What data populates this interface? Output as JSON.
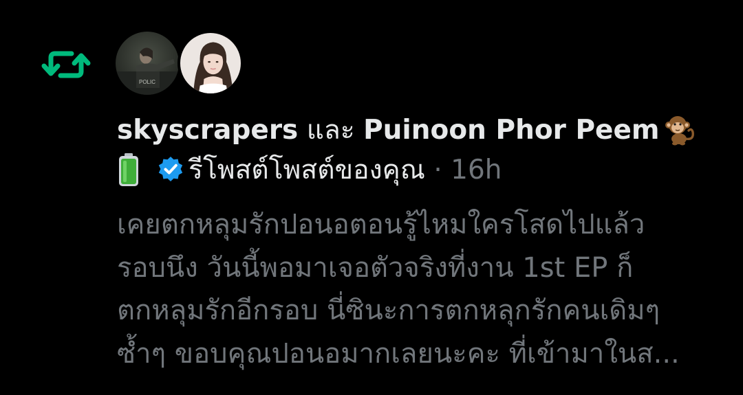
{
  "notification": {
    "user1": "skyscrapers",
    "conjunction": "และ",
    "user2": "Puinoon Phor Peem",
    "user2_emoji": "monkey-icon",
    "user2_badge_emoji": "battery-icon",
    "action": "รีโพสต์โพสต์ของคุณ",
    "separator": "·",
    "time": "16h",
    "post_text": "เคยตกหลุมรักปอนอตอนรู้ไหมใครโสดไปแล้ว\nรอบนึง วันนี้พอมาเจอตัวจริงที่งาน 1st EP ก็\nตกหลุมรักอีกรอบ นี่ซินะการตกหลุกรักคนเดิมๆ\nซ้ำๆ ขอบคุณปอนอมากเลยนะคะ ที่เข้ามาในส..."
  },
  "colors": {
    "background": "#000000",
    "retweet_green": "#00ba7c",
    "verified_blue": "#1d9bf0",
    "primary_text": "#e7e9ea",
    "muted_text": "#71767b"
  }
}
